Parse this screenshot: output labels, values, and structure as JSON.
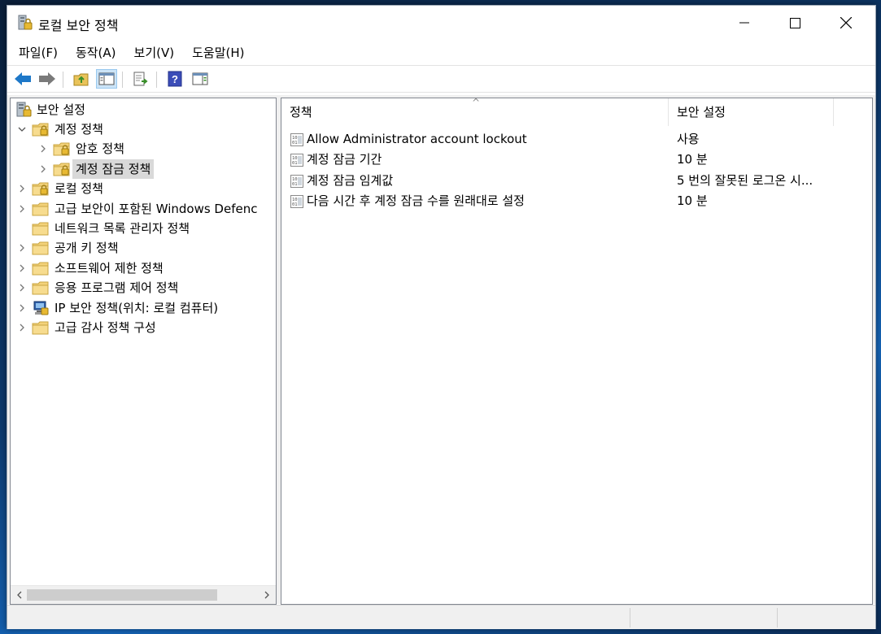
{
  "window": {
    "title": "로컬 보안 정책"
  },
  "menu": {
    "file": "파일(F)",
    "action": "동작(A)",
    "view": "보기(V)",
    "help": "도움말(H)"
  },
  "toolbar": {
    "buttons": [
      "back-icon",
      "forward-icon",
      "up-folder-icon",
      "show-hide-tree-icon",
      "export-list-icon",
      "help-icon",
      "show-action-pane-icon"
    ]
  },
  "tree": {
    "root": "보안 설정",
    "items": [
      {
        "label": "계정 정책",
        "level": 1,
        "expanded": true
      },
      {
        "label": "암호 정책",
        "level": 2
      },
      {
        "label": "계정 잠금 정책",
        "level": 2,
        "selected": true
      },
      {
        "label": "로컬 정책",
        "level": 1
      },
      {
        "label": "고급 보안이 포함된 Windows Defenc",
        "level": 1
      },
      {
        "label": "네트워크 목록 관리자 정책",
        "level": 1
      },
      {
        "label": "공개 키 정책",
        "level": 1
      },
      {
        "label": "소프트웨어 제한 정책",
        "level": 1
      },
      {
        "label": "응용 프로그램 제어 정책",
        "level": 1
      },
      {
        "label": "IP 보안 정책(위치: 로컬 컴퓨터)",
        "level": 1
      },
      {
        "label": "고급 감사 정책 구성",
        "level": 1
      }
    ]
  },
  "list": {
    "columns": [
      "정책",
      "보안 설정"
    ],
    "rows": [
      {
        "policy": "Allow Administrator account lockout",
        "setting": "사용"
      },
      {
        "policy": "계정 잠금 기간",
        "setting": "10 분"
      },
      {
        "policy": "계정 잠금 임계값",
        "setting": "5 번의 잘못된 로그온 시..."
      },
      {
        "policy": "다음 시간 후 계정 잠금 수를 원래대로 설정",
        "setting": "10 분"
      }
    ]
  },
  "colors": {
    "selection": "#d9d9d9",
    "folder": "#f3d27a",
    "accent_blue": "#1e78c8"
  }
}
